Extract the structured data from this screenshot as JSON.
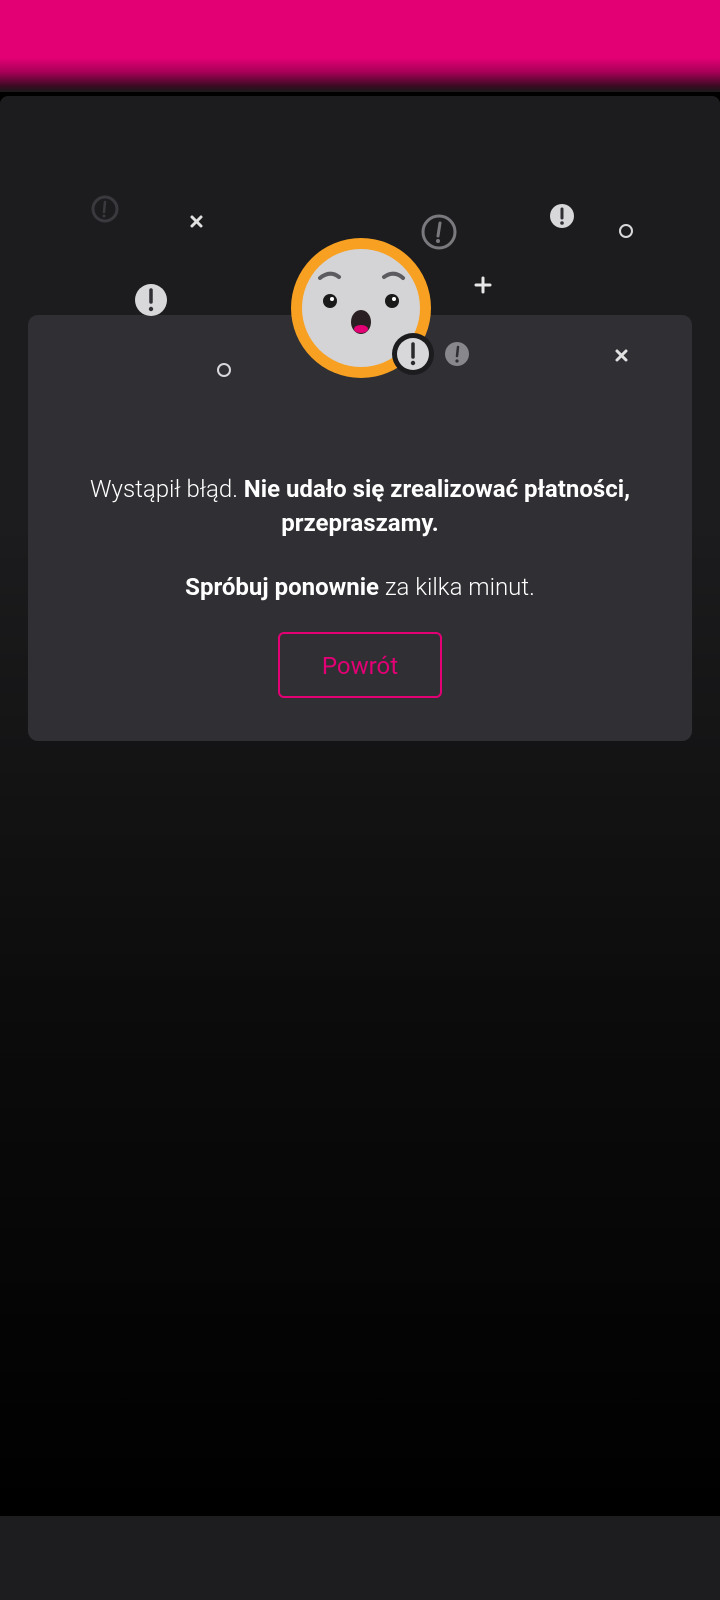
{
  "colors": {
    "brand": "#e20074",
    "card": "#2f2f34",
    "face_ring": "#f7a021",
    "face": "#d4d4d6"
  },
  "error": {
    "message_part1": "Wystąpił błąd. ",
    "message_part2": "Nie udało się zrealizować płatności, przepraszamy.",
    "retry_bold": "Spróbuj ponownie",
    "retry_rest": " za kilka minut."
  },
  "actions": {
    "back_label": "Powrót"
  },
  "icons": [
    "surprised-face-icon",
    "exclamation-icon",
    "close-icon",
    "plus-icon",
    "circle-icon"
  ]
}
